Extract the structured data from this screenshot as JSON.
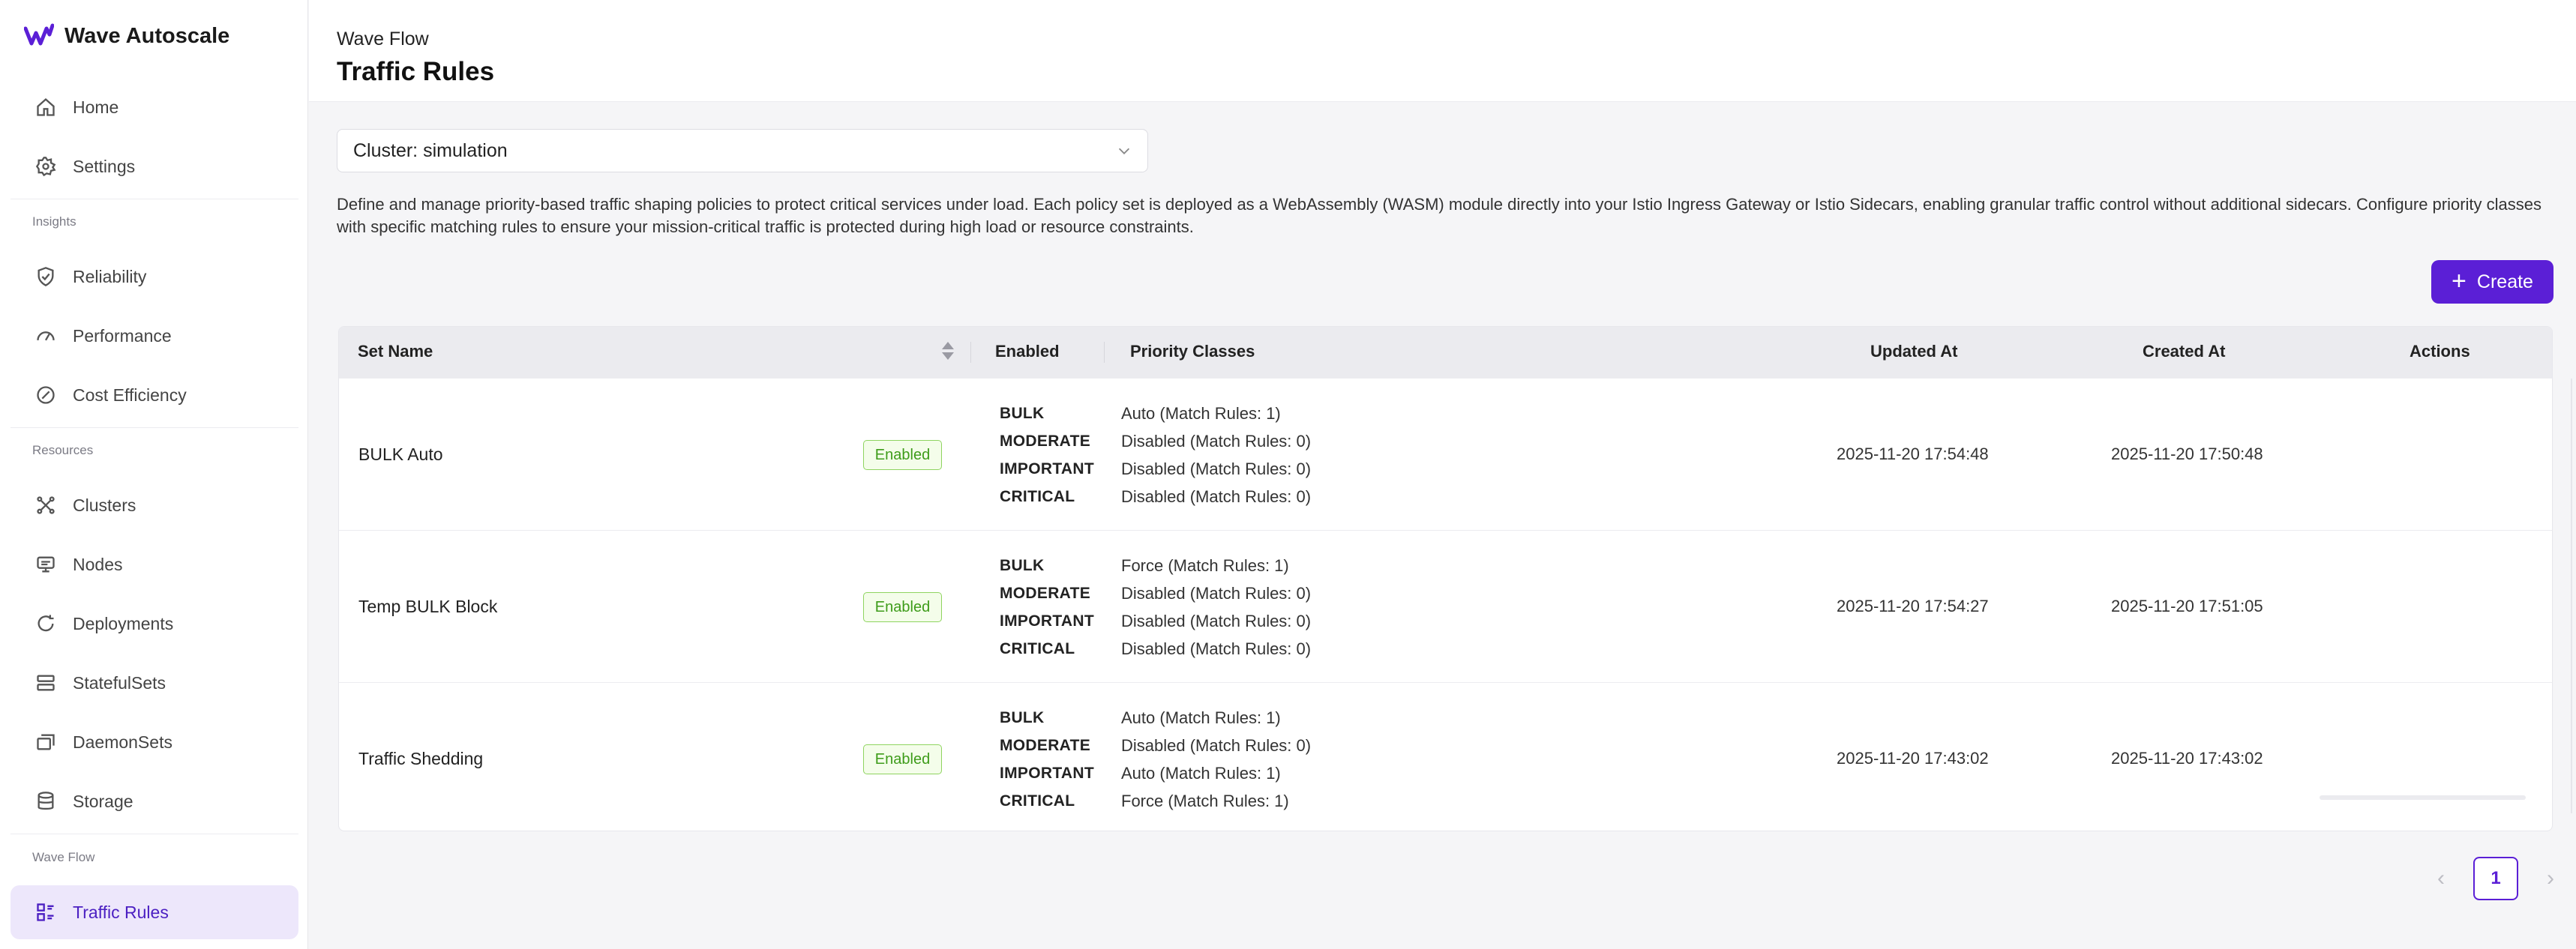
{
  "brand": {
    "name": "Wave Autoscale"
  },
  "sidebar": {
    "items_top": [
      {
        "label": "Home",
        "icon": "home-icon"
      },
      {
        "label": "Settings",
        "icon": "gear-icon"
      }
    ],
    "insights_label": "Insights",
    "insights": [
      {
        "label": "Reliability",
        "icon": "shield-icon"
      },
      {
        "label": "Performance",
        "icon": "gauge-icon"
      },
      {
        "label": "Cost Efficiency",
        "icon": "slash-circle-icon"
      }
    ],
    "resources_label": "Resources",
    "resources": [
      {
        "label": "Clusters",
        "icon": "cluster-icon"
      },
      {
        "label": "Nodes",
        "icon": "monitor-icon"
      },
      {
        "label": "Deployments",
        "icon": "refresh-icon"
      },
      {
        "label": "StatefulSets",
        "icon": "stack-icon"
      },
      {
        "label": "DaemonSets",
        "icon": "layers-icon"
      },
      {
        "label": "Storage",
        "icon": "database-icon"
      }
    ],
    "waveflow_label": "Wave Flow",
    "waveflow": [
      {
        "label": "Traffic Rules",
        "icon": "rules-icon",
        "active": true
      }
    ]
  },
  "header": {
    "breadcrumb": "Wave Flow",
    "title": "Traffic Rules"
  },
  "cluster_select": {
    "value": "Cluster: simulation"
  },
  "description": "Define and manage priority-based traffic shaping policies to protect critical services under load. Each policy set is deployed as a WebAssembly (WASM) module directly into your Istio Ingress Gateway or Istio Sidecars, enabling granular traffic control without additional sidecars. Configure priority classes with specific matching rules to ensure your mission-critical traffic is protected during high load or resource constraints.",
  "create_button": {
    "label": "Create"
  },
  "table": {
    "columns": {
      "set_name": "Set Name",
      "enabled": "Enabled",
      "priority_classes": "Priority Classes",
      "updated_at": "Updated At",
      "created_at": "Created At",
      "actions": "Actions"
    },
    "rows": [
      {
        "name": "BULK Auto",
        "enabled": "Enabled",
        "classes": [
          {
            "name": "BULK",
            "value": "Auto   (Match Rules: 1)"
          },
          {
            "name": "MODERATE",
            "value": "Disabled   (Match Rules: 0)"
          },
          {
            "name": "IMPORTANT",
            "value": "Disabled   (Match Rules: 0)"
          },
          {
            "name": "CRITICAL",
            "value": "Disabled   (Match Rules: 0)"
          }
        ],
        "updated_at": "2025-11-20 17:54:48",
        "created_at": "2025-11-20 17:50:48"
      },
      {
        "name": "Temp BULK Block",
        "enabled": "Enabled",
        "classes": [
          {
            "name": "BULK",
            "value": "Force   (Match Rules: 1)"
          },
          {
            "name": "MODERATE",
            "value": "Disabled   (Match Rules: 0)"
          },
          {
            "name": "IMPORTANT",
            "value": "Disabled   (Match Rules: 0)"
          },
          {
            "name": "CRITICAL",
            "value": "Disabled   (Match Rules: 0)"
          }
        ],
        "updated_at": "2025-11-20 17:54:27",
        "created_at": "2025-11-20 17:51:05"
      },
      {
        "name": "Traffic Shedding",
        "enabled": "Enabled",
        "classes": [
          {
            "name": "BULK",
            "value": "Auto   (Match Rules: 1)"
          },
          {
            "name": "MODERATE",
            "value": "Disabled   (Match Rules: 0)"
          },
          {
            "name": "IMPORTANT",
            "value": "Auto   (Match Rules: 1)"
          },
          {
            "name": "CRITICAL",
            "value": "Force   (Match Rules: 1)"
          }
        ],
        "updated_at": "2025-11-20 17:43:02",
        "created_at": "2025-11-20 17:43:02"
      }
    ]
  },
  "pagination": {
    "current": "1",
    "prev": "‹",
    "next": "›"
  },
  "colors": {
    "accent": "#5b1fd6",
    "active_bg": "#ede7fb",
    "enabled_green": "#3e9c1a"
  }
}
